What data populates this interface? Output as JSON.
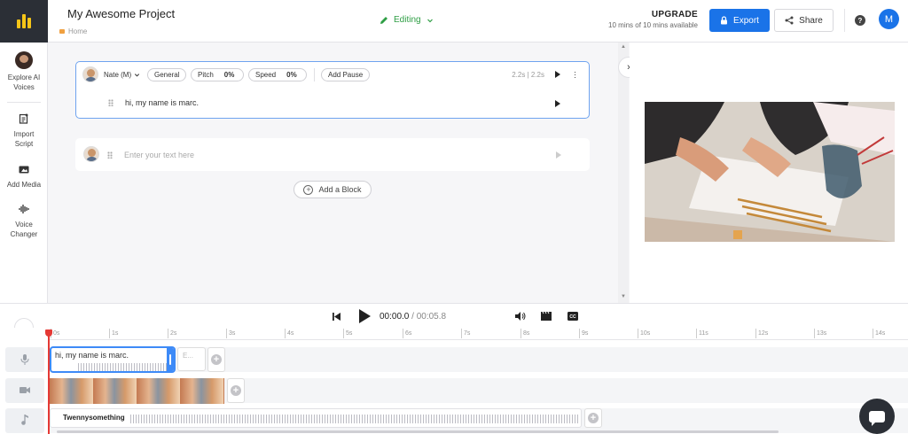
{
  "header": {
    "project_title": "My Awesome Project",
    "breadcrumb": "Home",
    "mode_label": "Editing",
    "upgrade_title": "UPGRADE",
    "upgrade_sub": "10 mins of 10 mins available",
    "export_label": "Export",
    "share_label": "Share",
    "help_label": "?",
    "user_initial": "M"
  },
  "sidebar": {
    "items": [
      {
        "label": "Explore AI Voices",
        "icon": "voice-avatar-icon"
      },
      {
        "label": "Import Script",
        "icon": "import-script-icon"
      },
      {
        "label": "Add Media",
        "icon": "add-media-icon"
      },
      {
        "label": "Voice Changer",
        "icon": "voice-changer-icon"
      }
    ]
  },
  "editor": {
    "block1": {
      "voice": "Nate (M)",
      "style": "General",
      "pitch_label": "Pitch",
      "pitch_value": "0%",
      "speed_label": "Speed",
      "speed_value": "0%",
      "add_pause": "Add Pause",
      "duration": "2.2s | 2.2s",
      "text": "hi, my name is marc."
    },
    "block2": {
      "placeholder": "Enter your text here"
    },
    "add_block_label": "Add a Block"
  },
  "playback": {
    "current": "00:00.0",
    "separator": "/",
    "total": "00:05.8"
  },
  "timeline": {
    "ticks": [
      "0s",
      "1s",
      "2s",
      "3s",
      "4s",
      "5s",
      "6s",
      "7s",
      "8s",
      "9s",
      "10s",
      "11s",
      "12s",
      "13s",
      "14s"
    ],
    "voice_clip_text": "hi, my name is marc.",
    "ghost_clip_text": "E...",
    "music_clip_text": "Twennysomething"
  },
  "colors": {
    "accent": "#1a73e8",
    "editing": "#2e9e44",
    "playhead": "#e53935",
    "logo_bg": "#2b2f36",
    "logo_mark": "#f5c518"
  }
}
